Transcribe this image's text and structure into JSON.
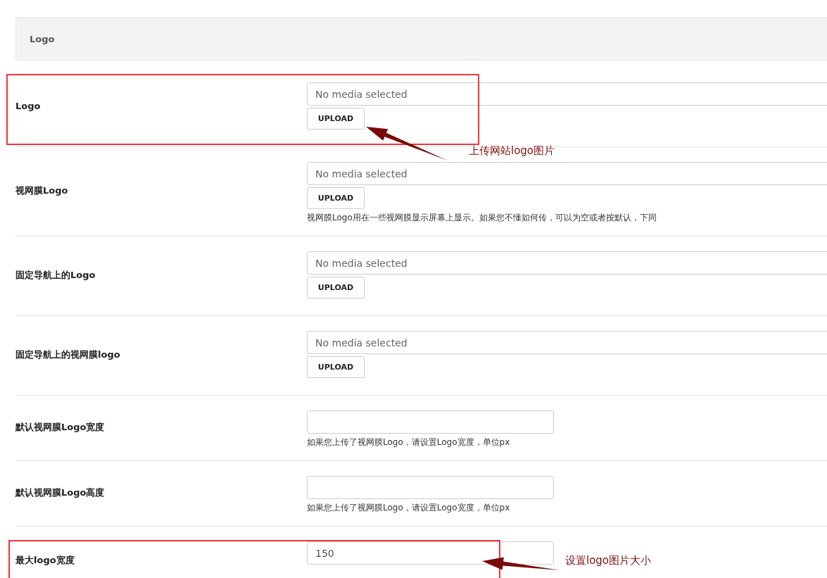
{
  "section": {
    "title": "Logo"
  },
  "fields": [
    {
      "kind": "media",
      "label": "Logo",
      "placeholder": "No media selected",
      "button": "UPLOAD"
    },
    {
      "kind": "media",
      "label": "视网膜Logo",
      "placeholder": "No media selected",
      "button": "UPLOAD",
      "help": "视网膜Logo用在一些视网膜显示屏幕上显示。如果您不懂如何传，可以为空或者按默认，下同"
    },
    {
      "kind": "media",
      "label": "固定导航上的Logo",
      "placeholder": "No media selected",
      "button": "UPLOAD"
    },
    {
      "kind": "media",
      "label": "固定导航上的视网膜logo",
      "placeholder": "No media selected",
      "button": "UPLOAD"
    },
    {
      "kind": "text",
      "label": "默认视网膜Logo宽度",
      "help": "如果您上传了视网膜Logo，请设置Logo宽度，单位px"
    },
    {
      "kind": "text",
      "label": "默认视网膜Logo高度",
      "help": "如果您上传了视网膜Logo，请设置Logo宽度，单位px"
    },
    {
      "kind": "text",
      "label": "最大logo宽度",
      "value": "150"
    }
  ],
  "annotations": [
    {
      "text": "上传网站logo图片"
    },
    {
      "text": "设置logo图片大小"
    }
  ]
}
